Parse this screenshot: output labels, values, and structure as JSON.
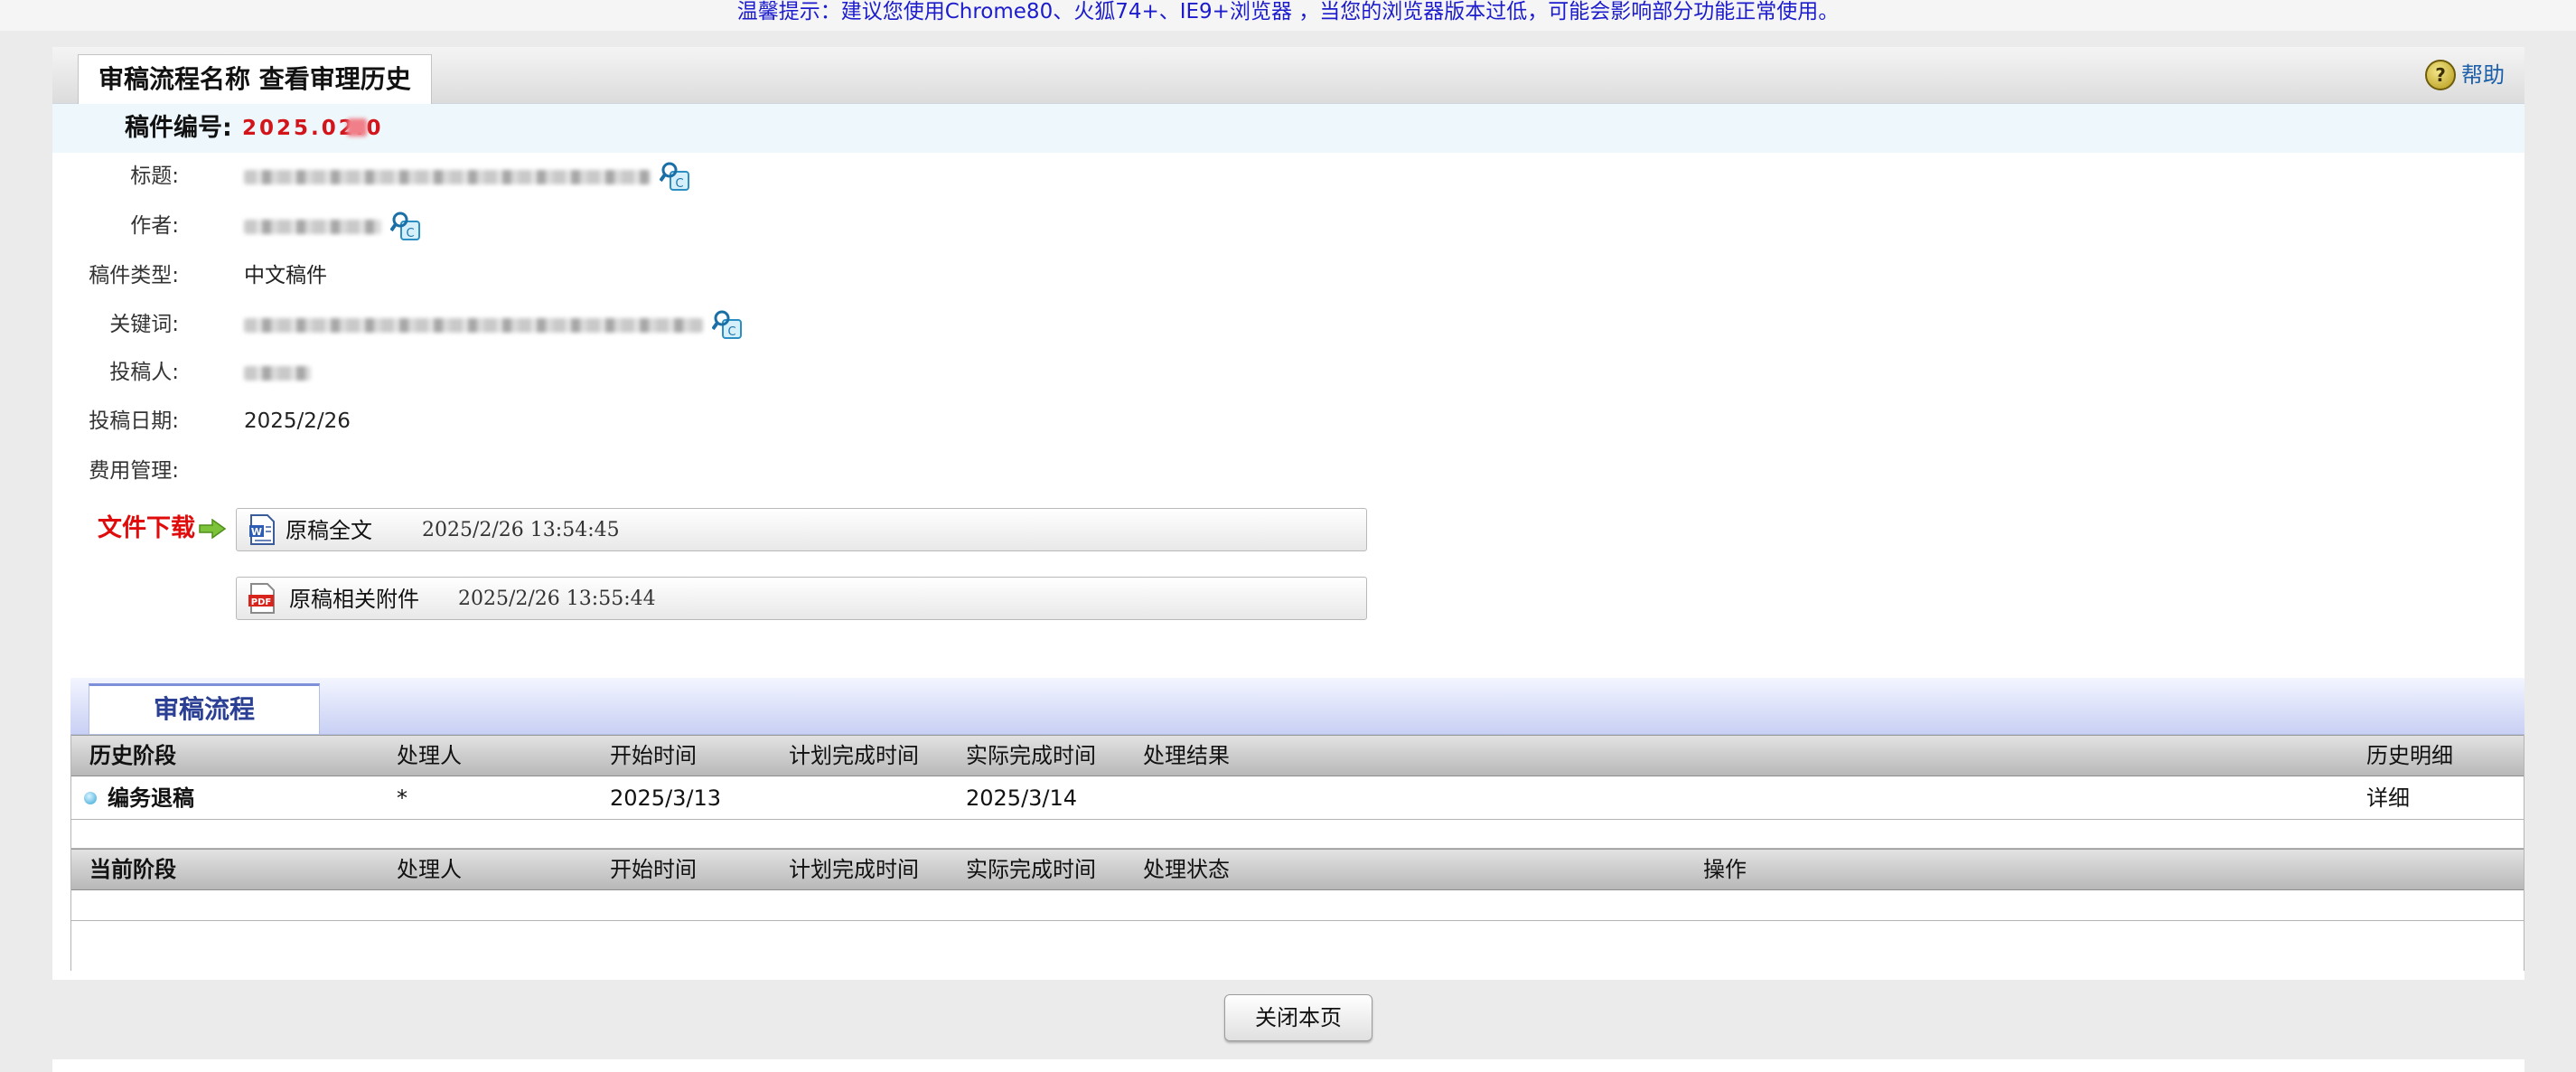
{
  "notice": "温馨提示：建议您使用Chrome80、火狐74+、IE9+浏览器 ，当您的浏览器版本过低，可能会影响部分功能正常使用。",
  "header": {
    "title": "审稿流程名称 查看审理历史",
    "help_label": "帮助",
    "help_icon": "help-icon"
  },
  "manuscript": {
    "number_label": "稿件编号:",
    "number_value": "2025.02.0"
  },
  "fields": {
    "title_label": "标题:",
    "author_label": "作者:",
    "type_label": "稿件类型:",
    "type_value": "中文稿件",
    "keywords_label": "关键词:",
    "submitter_label": "投稿人:",
    "date_label": "投稿日期:",
    "date_value": "2025/2/26",
    "fee_label": "费用管理:"
  },
  "downloads": {
    "label": "文件下载",
    "files": [
      {
        "name": "原稿全文",
        "time": "2025/2/26 13:54:45",
        "icon": "word-file-icon"
      },
      {
        "name": "原稿相关附件",
        "time": "2025/2/26 13:55:44",
        "icon": "pdf-file-icon"
      }
    ]
  },
  "flow": {
    "tab_label": "审稿流程",
    "history_headers": [
      "历史阶段",
      "处理人",
      "开始时间",
      "计划完成时间",
      "实际完成时间",
      "处理结果",
      "历史明细"
    ],
    "history_rows": [
      {
        "stage": "编务退稿",
        "handler": "*",
        "start": "2025/3/13",
        "planned": "",
        "actual": "2025/3/14",
        "result": "",
        "detail": "详细"
      }
    ],
    "current_headers": [
      "当前阶段",
      "处理人",
      "开始时间",
      "计划完成时间",
      "实际完成时间",
      "处理状态",
      "操作"
    ]
  },
  "footer": {
    "close_label": "关闭本页"
  },
  "colors": {
    "notice_text": "#1c1ccc",
    "manuscript_number": "#d2151b",
    "download_label": "#e00c0c",
    "flow_tab_text": "#2b3f94"
  }
}
